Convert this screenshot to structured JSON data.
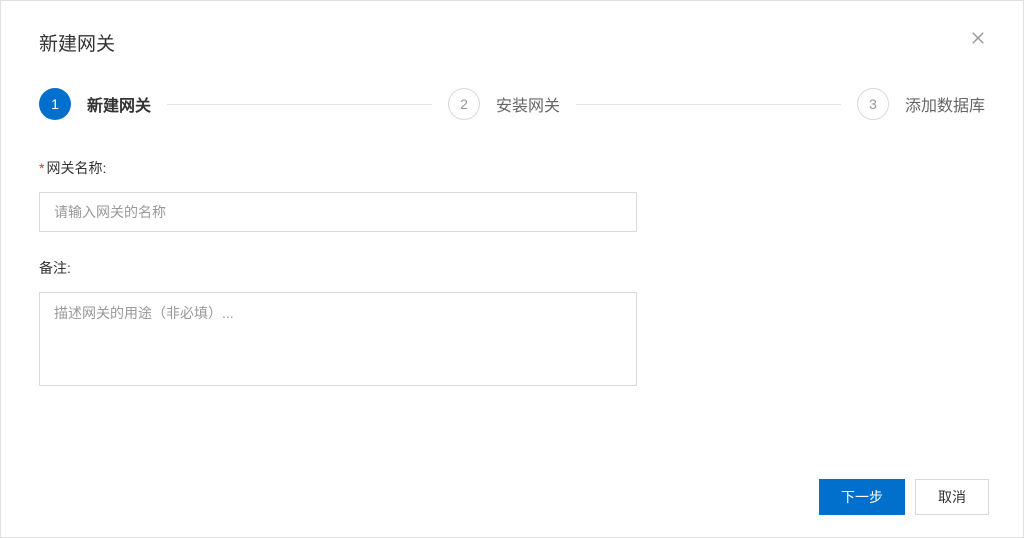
{
  "modal": {
    "title": "新建网关"
  },
  "stepper": {
    "steps": [
      {
        "num": "1",
        "label": "新建网关"
      },
      {
        "num": "2",
        "label": "安装网关"
      },
      {
        "num": "3",
        "label": "添加数据库"
      }
    ]
  },
  "form": {
    "name": {
      "label": "网关名称:",
      "placeholder": "请输入网关的名称",
      "value": ""
    },
    "remark": {
      "label": "备注:",
      "placeholder": "描述网关的用途（非必填）...",
      "value": ""
    }
  },
  "footer": {
    "next": "下一步",
    "cancel": "取消"
  }
}
